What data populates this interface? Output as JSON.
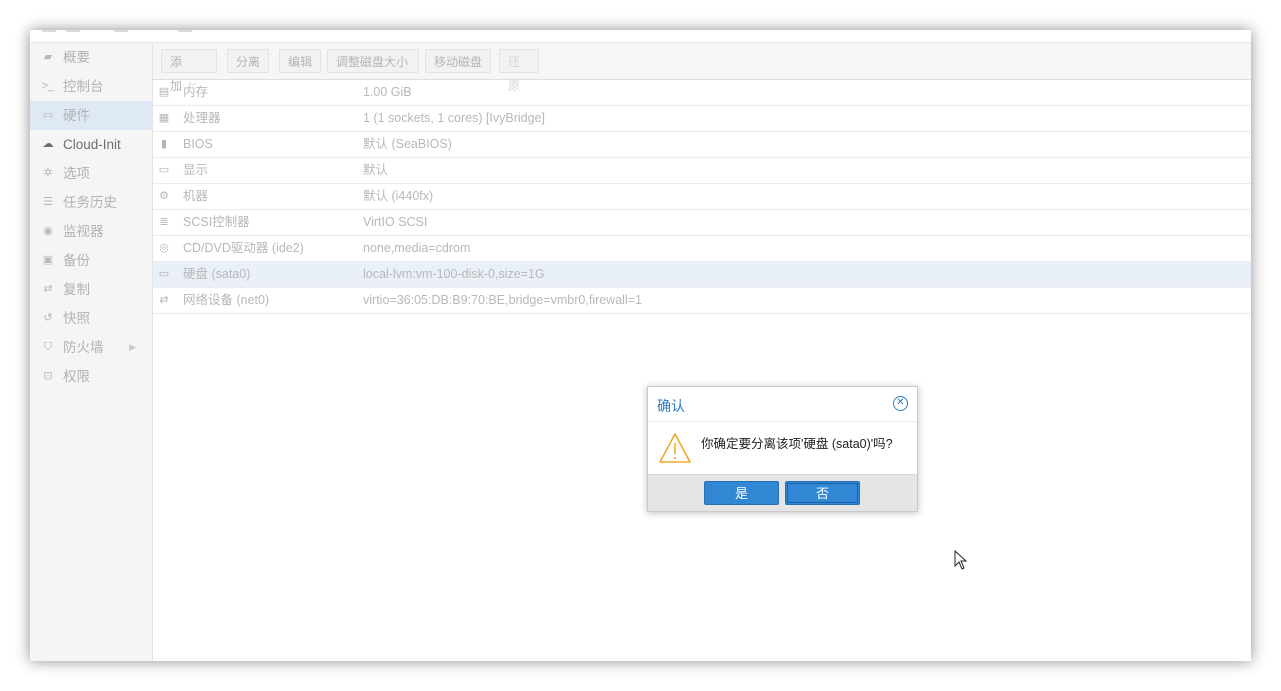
{
  "sidebar": {
    "items": [
      {
        "label": "概要",
        "icon": "book-icon",
        "glyph": "▰",
        "active": false,
        "dark": false
      },
      {
        "label": "控制台",
        "icon": "terminal-icon",
        "glyph": ">_",
        "active": false,
        "dark": false
      },
      {
        "label": "硬件",
        "icon": "desktop-icon",
        "glyph": "▭",
        "active": true,
        "dark": false
      },
      {
        "label": "Cloud-Init",
        "icon": "cloud-icon",
        "glyph": "☁",
        "active": false,
        "dark": true
      },
      {
        "label": "选项",
        "icon": "gear-icon",
        "glyph": "✲",
        "active": false,
        "dark": false
      },
      {
        "label": "任务历史",
        "icon": "list-icon",
        "glyph": "☰",
        "active": false,
        "dark": false
      },
      {
        "label": "监视器",
        "icon": "eye-icon",
        "glyph": "◉",
        "active": false,
        "dark": false
      },
      {
        "label": "备份",
        "icon": "floppy-icon",
        "glyph": "▣",
        "active": false,
        "dark": false
      },
      {
        "label": "复制",
        "icon": "retweet-icon",
        "glyph": "⇄",
        "active": false,
        "dark": false
      },
      {
        "label": "快照",
        "icon": "history-icon",
        "glyph": "↺",
        "active": false,
        "dark": false
      },
      {
        "label": "防火墙",
        "icon": "shield-icon",
        "glyph": "⛉",
        "active": false,
        "dark": false,
        "has_arrow": true
      },
      {
        "label": "权限",
        "icon": "unlock-icon",
        "glyph": "⊡",
        "active": false,
        "dark": false
      }
    ]
  },
  "toolbar": {
    "add_label": "添加",
    "detach_label": "分离",
    "edit_label": "编辑",
    "resize_label": "调整磁盘大小",
    "move_label": "移动磁盘",
    "revert_label": "还原"
  },
  "hardware": {
    "rows": [
      {
        "icon": "memory-icon",
        "glyph": "▤",
        "key": "内存",
        "value": "1.00 GiB",
        "selected": false,
        "dark": false
      },
      {
        "icon": "cpu-icon",
        "glyph": "▦",
        "key": "处理器",
        "value": "1 (1 sockets, 1 cores) [IvyBridge]",
        "selected": false,
        "dark": false
      },
      {
        "icon": "chip-icon",
        "glyph": "▮",
        "key": "BIOS",
        "value": "默认 (SeaBIOS)",
        "selected": false,
        "dark": false
      },
      {
        "icon": "monitor-icon",
        "glyph": "▭",
        "key": "显示",
        "value": "默认",
        "selected": false,
        "dark": false
      },
      {
        "icon": "cogs-icon",
        "glyph": "⚙",
        "key": "机器",
        "value": "默认 (i440fx)",
        "selected": false,
        "dark": false
      },
      {
        "icon": "database-icon",
        "glyph": "≣",
        "key": "SCSI控制器",
        "value": "VirtIO SCSI",
        "selected": false,
        "dark": false
      },
      {
        "icon": "cdrom-icon",
        "glyph": "◎",
        "key": "CD/DVD驱动器 (ide2)",
        "value": "none,media=cdrom",
        "selected": false,
        "dark": false
      },
      {
        "icon": "hdd-icon",
        "glyph": "▭",
        "key": "硬盘 (sata0)",
        "value": "local-lvm:vm-100-disk-0,size=1G",
        "selected": true,
        "dark": false
      },
      {
        "icon": "exchange-icon",
        "glyph": "⇄",
        "key": "网络设备 (net0)",
        "value": "virtio=36:05:DB:B9:70:BE,bridge=vmbr0,firewall=1",
        "selected": false,
        "dark": false
      }
    ]
  },
  "dialog": {
    "title": "确认",
    "message": "你确定要分离该项'硬盘 (sata0)'吗?",
    "yes_label": "是",
    "no_label": "否",
    "accent_color": "#2f79c0"
  }
}
